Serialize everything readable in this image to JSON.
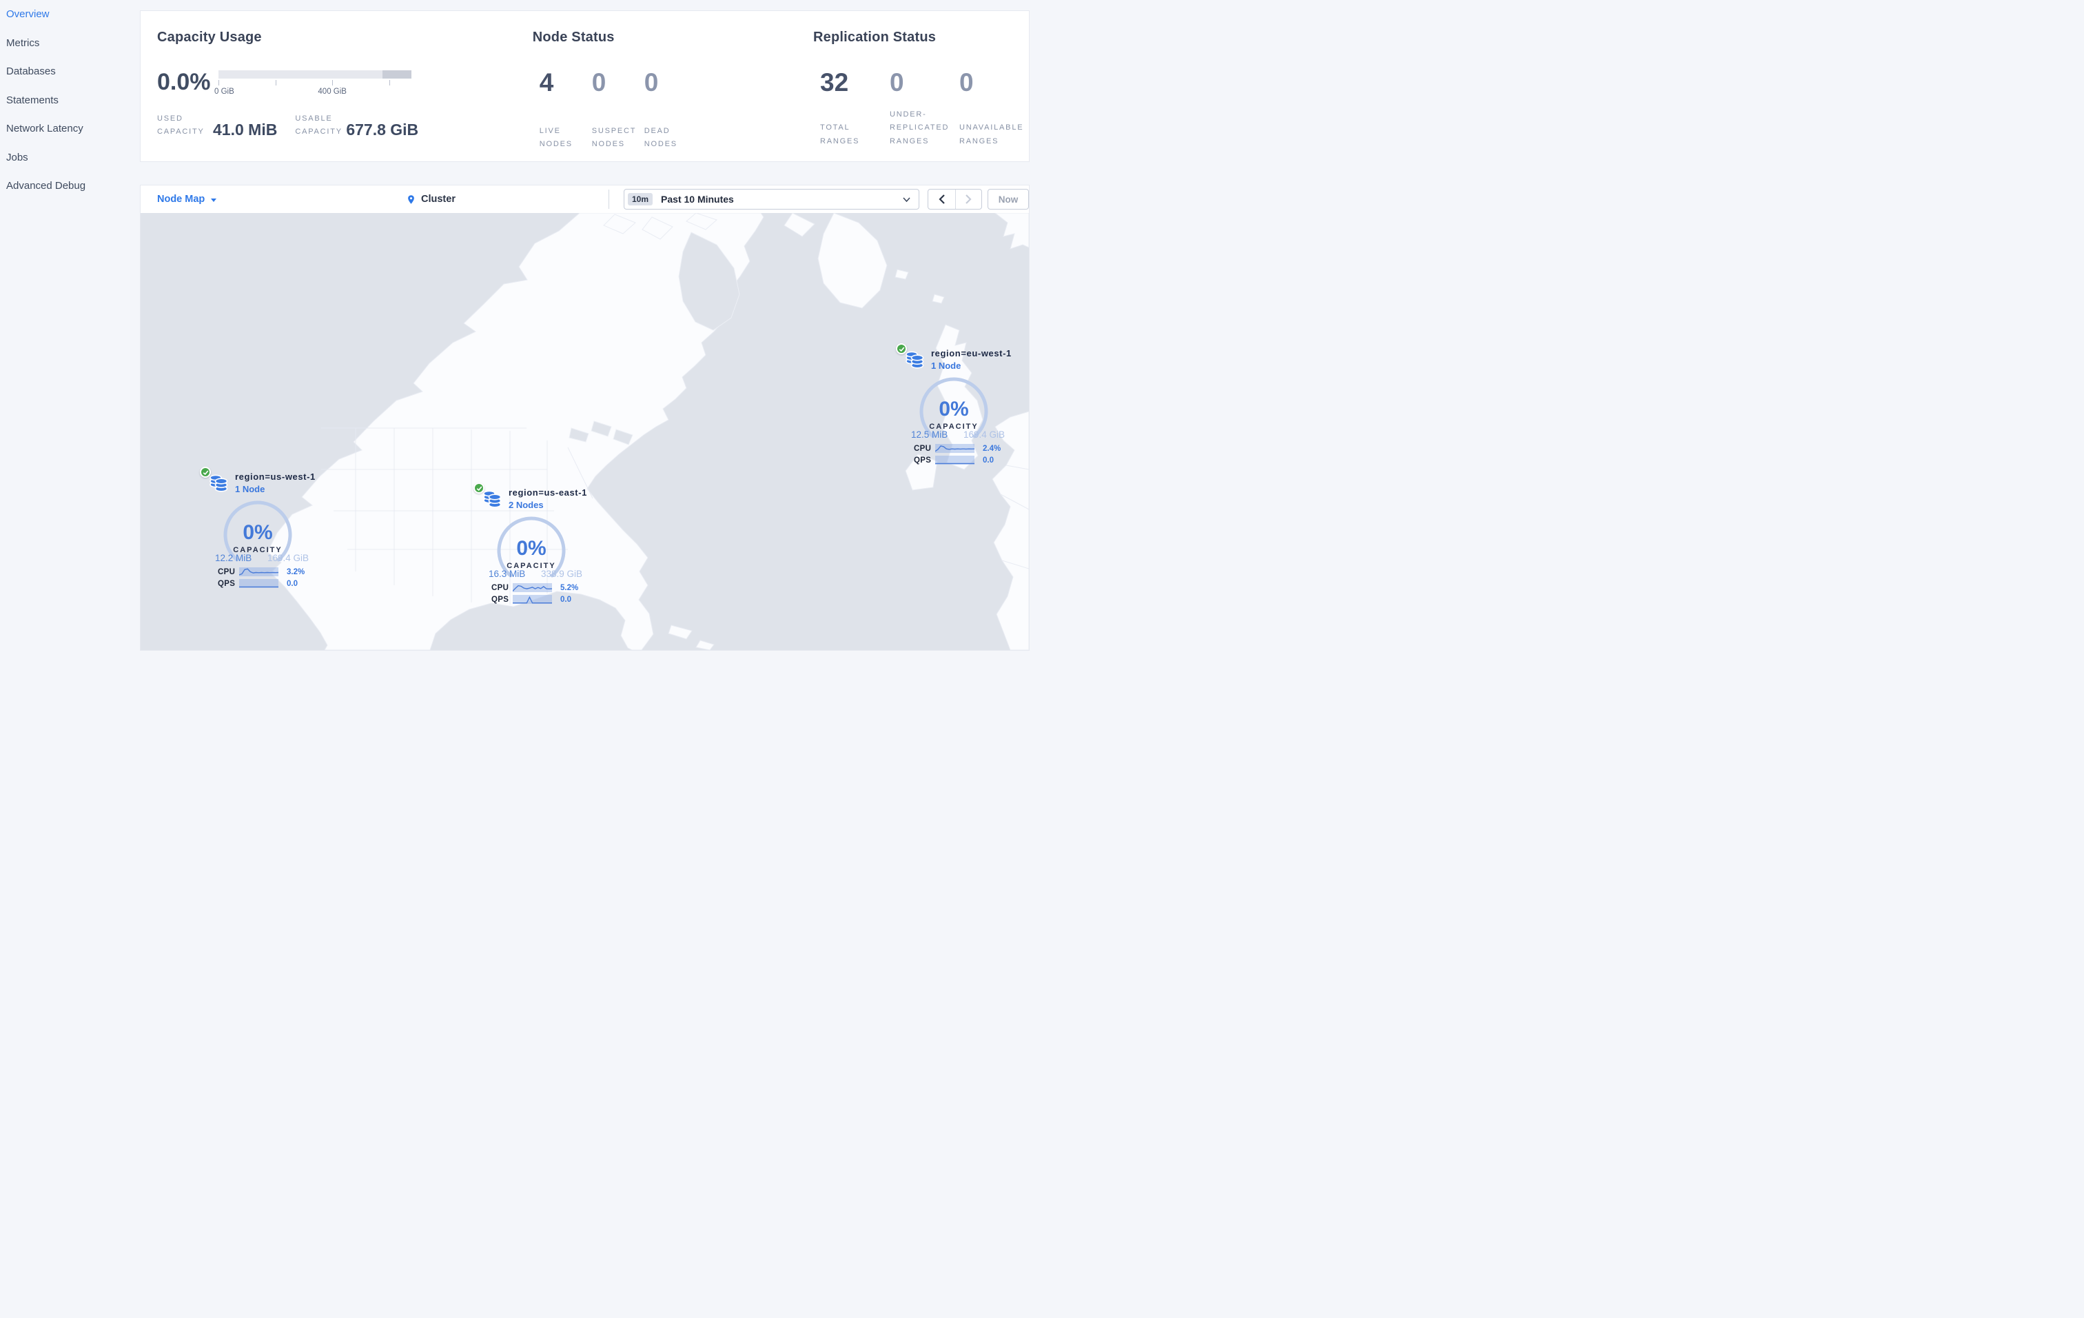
{
  "sidebar": {
    "items": [
      {
        "label": "Overview",
        "active": true
      },
      {
        "label": "Metrics"
      },
      {
        "label": "Databases"
      },
      {
        "label": "Statements"
      },
      {
        "label": "Network Latency"
      },
      {
        "label": "Jobs"
      },
      {
        "label": "Advanced Debug"
      }
    ]
  },
  "stats": {
    "capacity": {
      "title": "Capacity Usage",
      "percent": "0.0%",
      "tick_labels": [
        "0 GiB",
        "400 GiB"
      ],
      "used_label": "USED CAPACITY",
      "used_value": "41.0 MiB",
      "usable_label": "USABLE CAPACITY",
      "usable_value": "677.8 GiB"
    },
    "nodes": {
      "title": "Node Status",
      "items": [
        {
          "value": "4",
          "label": "LIVE NODES"
        },
        {
          "value": "0",
          "label": "SUSPECT NODES"
        },
        {
          "value": "0",
          "label": "DEAD NODES"
        }
      ]
    },
    "replication": {
      "title": "Replication Status",
      "items": [
        {
          "value": "32",
          "label": "TOTAL RANGES"
        },
        {
          "value": "0",
          "label": "UNDER-REPLICATED RANGES"
        },
        {
          "value": "0",
          "label": "UNAVAILABLE RANGES"
        }
      ]
    }
  },
  "toolbar": {
    "view_label": "Node Map",
    "breadcrumb": "Cluster",
    "range_badge": "10m",
    "range_label": "Past 10 Minutes",
    "now_label": "Now"
  },
  "map": {
    "regions": [
      {
        "name": "region=us-west-1",
        "nodes": "1 Node",
        "percent": "0%",
        "capacity_label": "CAPACITY",
        "used": "12.2 MiB",
        "total": "169.4 GiB",
        "cpu_label": "CPU",
        "cpu_value": "3.2%",
        "cpu_spark": [
          0.85,
          0.72,
          0.25,
          0.18,
          0.5,
          0.62,
          0.58,
          0.6,
          0.58,
          0.6,
          0.58,
          0.59,
          0.58,
          0.59,
          0.58
        ],
        "qps_label": "QPS",
        "qps_value": "0.0",
        "qps_spark": [
          0.88,
          0.88,
          0.88,
          0.88,
          0.88,
          0.88,
          0.88,
          0.88,
          0.88,
          0.88,
          0.88,
          0.88,
          0.88,
          0.88,
          0.88
        ]
      },
      {
        "name": "region=us-east-1",
        "nodes": "2 Nodes",
        "percent": "0%",
        "capacity_label": "CAPACITY",
        "used": "16.3 MiB",
        "total": "338.9 GiB",
        "cpu_label": "CPU",
        "cpu_value": "5.2%",
        "cpu_spark": [
          0.88,
          0.55,
          0.28,
          0.35,
          0.55,
          0.62,
          0.55,
          0.45,
          0.62,
          0.48,
          0.6,
          0.38,
          0.62,
          0.64,
          0.62
        ],
        "qps_label": "QPS",
        "qps_value": "0.0",
        "qps_spark": [
          0.9,
          0.9,
          0.9,
          0.9,
          0.9,
          0.9,
          0.25,
          0.9,
          0.9,
          0.9,
          0.9,
          0.9,
          0.9,
          0.9,
          0.9
        ]
      },
      {
        "name": "region=eu-west-1",
        "nodes": "1 Node",
        "percent": "0%",
        "capacity_label": "CAPACITY",
        "used": "12.5 MiB",
        "total": "169.4 GiB",
        "cpu_label": "CPU",
        "cpu_value": "2.4%",
        "cpu_spark": [
          0.82,
          0.6,
          0.22,
          0.3,
          0.55,
          0.6,
          0.55,
          0.58,
          0.55,
          0.57,
          0.55,
          0.57,
          0.55,
          0.56,
          0.55
        ],
        "qps_label": "QPS",
        "qps_value": "0.0",
        "qps_spark": [
          0.88,
          0.88,
          0.88,
          0.88,
          0.88,
          0.88,
          0.88,
          0.88,
          0.88,
          0.88,
          0.88,
          0.88,
          0.88,
          0.88,
          0.88
        ]
      }
    ]
  },
  "colors": {
    "accent_blue": "#2f79e8",
    "marker_blue": "#3a77dd",
    "gauge_arc": "#bccdeb",
    "ocean": "#dfe3ea",
    "land": "#fbfcfe",
    "healthy_green": "#49a84c"
  }
}
